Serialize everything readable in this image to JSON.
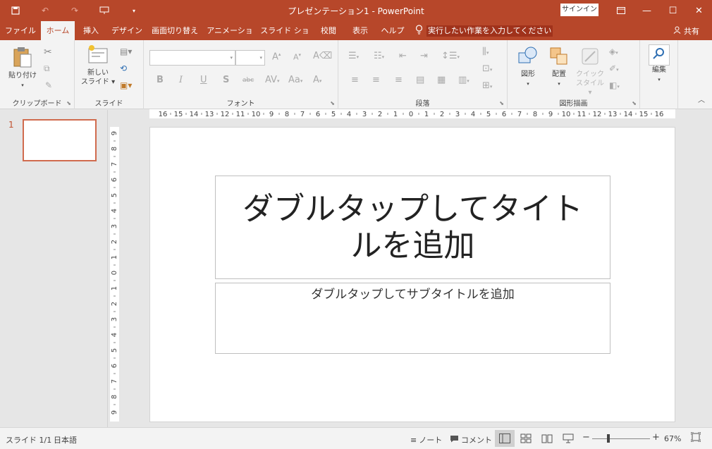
{
  "window": {
    "title": "プレゼンテーション1 - PowerPoint",
    "signin": "サインイン",
    "share": "共有"
  },
  "tabs": [
    "ファイル",
    "ホーム",
    "挿入",
    "デザイン",
    "画面切り替え",
    "アニメーション",
    "スライド ショー",
    "校閲",
    "表示",
    "ヘルプ"
  ],
  "active_tab": "ホーム",
  "tellme": "実行したい作業を入力してください",
  "ribbon": {
    "paste": "貼り付け",
    "clipboard": "クリップボード",
    "new_slide_1": "新しい",
    "new_slide_2": "スライド",
    "slides": "スライド",
    "font": "フォント",
    "paragraph": "段落",
    "shapes": "図形",
    "arrange": "配置",
    "quick_style_1": "クイック",
    "quick_style_2": "スタイル",
    "drawing": "図形描画",
    "edit": "編集"
  },
  "thumbnails": [
    {
      "number": "1"
    }
  ],
  "slide": {
    "title_placeholder": "ダブルタップしてタイトルを追加",
    "subtitle_placeholder": "ダブルタップしてサブタイトルを追加"
  },
  "ruler": {
    "horizontal": [
      "16",
      "15",
      "14",
      "13",
      "12",
      "11",
      "10",
      "9",
      "8",
      "7",
      "6",
      "5",
      "4",
      "3",
      "2",
      "1",
      "0",
      "1",
      "2",
      "3",
      "4",
      "5",
      "6",
      "7",
      "8",
      "9",
      "10",
      "11",
      "12",
      "13",
      "14",
      "15",
      "16"
    ],
    "vertical": [
      "9",
      "8",
      "7",
      "6",
      "5",
      "4",
      "3",
      "2",
      "1",
      "0",
      "1",
      "2",
      "3",
      "4",
      "5",
      "6",
      "7",
      "8",
      "9"
    ]
  },
  "status": {
    "slide_info": "スライド 1/1",
    "language": "日本語",
    "notes": "ノート",
    "comments": "コメント",
    "zoom": "67%"
  },
  "colors": {
    "accent": "#b7472a",
    "thumb_border": "#d06b4e"
  }
}
